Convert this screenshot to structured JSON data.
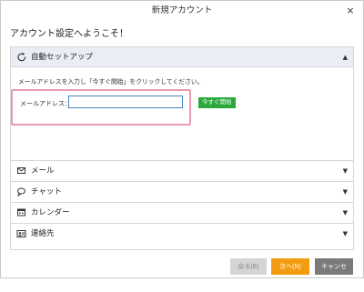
{
  "window": {
    "title": "新規アカウント",
    "close_glyph": "×"
  },
  "welcome": "アカウント設定へようこそ！",
  "auto_setup": {
    "label": "自動セットアップ",
    "description": "メールアドレスを入力し「今すぐ開始」をクリックしてください。",
    "email_label": "メールアドレス：",
    "email_value": "",
    "start_label": "今すぐ開始"
  },
  "sections": [
    {
      "label": "メール",
      "icon": "envelope-icon"
    },
    {
      "label": "チャット",
      "icon": "chat-icon"
    },
    {
      "label": "カレンダー",
      "icon": "calendar-icon"
    },
    {
      "label": "連絡先",
      "icon": "contact-card-icon"
    }
  ],
  "footer": {
    "back_label": "戻る(B)",
    "next_label": "次へ(N)",
    "cancel_label": "キャンセル"
  },
  "colors": {
    "start_button": "#2aa83c",
    "next_button": "#f39c12",
    "cancel_button": "#7a7a7a",
    "highlight_border": "#e89ab3"
  }
}
